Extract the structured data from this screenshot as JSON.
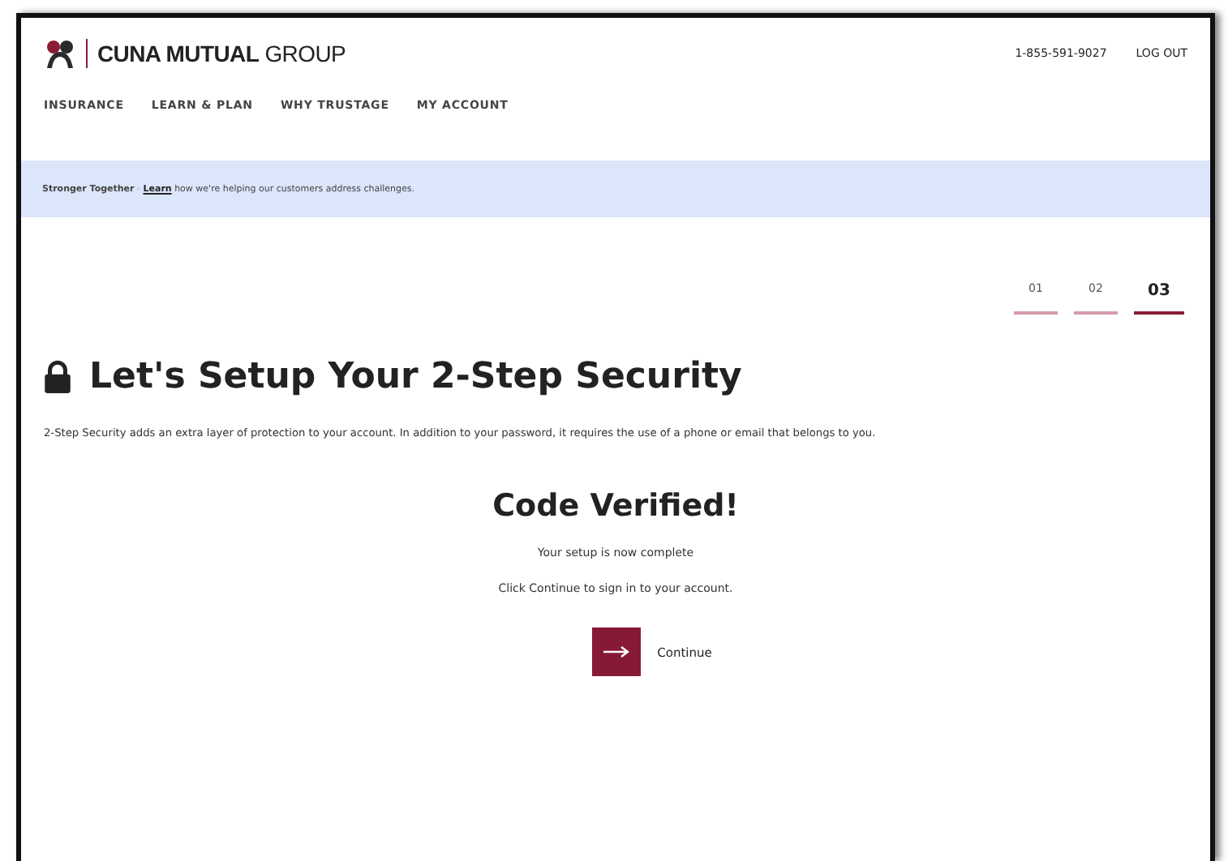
{
  "header": {
    "logo": "**CUNA MUTUAL** GROUP",
    "phone": "1-855-591-9027",
    "logout": "LOG OUT"
  },
  "nav": [
    {
      "label": "INSURANCE"
    },
    {
      "label": "LEARN & PLAN"
    },
    {
      "label": "WHY TRUSTAGE"
    },
    {
      "label": "MY ACCOUNT"
    }
  ],
  "banner": {
    "lead": "Stronger Together",
    "separator": "-",
    "link": "Learn",
    "text": "how we're helping our customers address challenges."
  },
  "steps": [
    {
      "label": "01",
      "selected": false
    },
    {
      "label": "02",
      "selected": false
    },
    {
      "label": "03",
      "selected": true
    }
  ],
  "title": "Let's Setup Your 2-Step Security",
  "intro": "2-Step Security adds an extra layer of protection to your account. In addition to your password, it requires the use of a phone or email that belongs to you.",
  "result": {
    "heading": "Code Verified!",
    "lines": [
      "Your setup is now complete",
      "Click Continue to sign in to your account."
    ],
    "button": "Continue"
  }
}
